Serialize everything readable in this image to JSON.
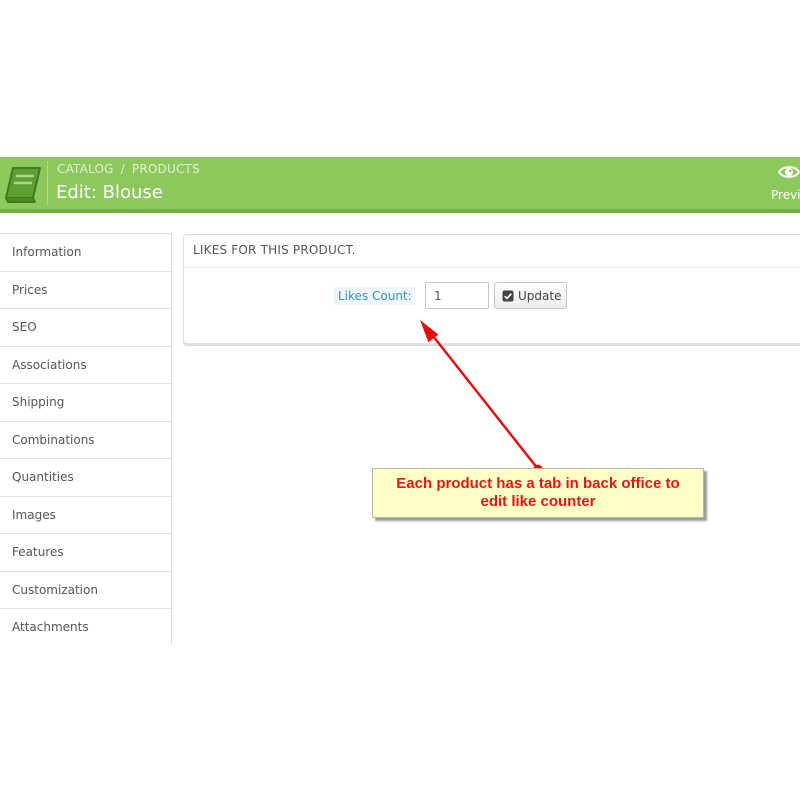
{
  "header": {
    "breadcrumb": [
      "CATALOG",
      "PRODUCTS"
    ],
    "breadcrumb_separator": "/",
    "title": "Edit: Blouse",
    "preview_label": "Previ",
    "icons": {
      "catalog": "book-icon",
      "preview": "eye-icon"
    },
    "colors": {
      "background": "#8dc85c",
      "border": "#72b041"
    }
  },
  "sidebar": {
    "items": [
      {
        "label": "Information"
      },
      {
        "label": "Prices"
      },
      {
        "label": "SEO"
      },
      {
        "label": "Associations"
      },
      {
        "label": "Shipping"
      },
      {
        "label": "Combinations"
      },
      {
        "label": "Quantities"
      },
      {
        "label": "Images"
      },
      {
        "label": "Features"
      },
      {
        "label": "Customization"
      },
      {
        "label": "Attachments"
      }
    ]
  },
  "panel": {
    "title": "LIKES FOR THIS PRODUCT.",
    "likes_label": "Likes Count:",
    "likes_value": "1",
    "update_label": "Update",
    "update_icon": "check-square-icon"
  },
  "annotation": {
    "lines": [
      "Each product has a tab in back office to",
      "edit like counter"
    ],
    "text_color": "#e21818",
    "background": "#ffffc8"
  }
}
